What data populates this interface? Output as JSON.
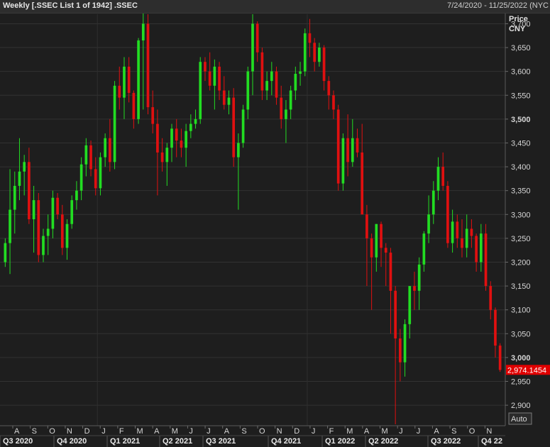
{
  "header": {
    "title": "Weekly [.SSEC List 1 of 1942] .SSEC",
    "date_range": "7/24/2020 - 11/25/2022 (NYC"
  },
  "axis": {
    "price_label": "Price",
    "currency_label": "CNY",
    "auto_button": "Auto",
    "last_price_label": "2,974.1454",
    "last_price_color": "#e00000"
  },
  "colors": {
    "up": "#22dd22",
    "down": "#e01010",
    "background": "#1e1e1e",
    "grid": "#333333"
  },
  "chart_data": {
    "type": "candlestick",
    "interval": "weekly",
    "instrument": ".SSEC",
    "ylim": [
      2860,
      3720
    ],
    "y_ticks": [
      2900,
      2950,
      3000,
      3050,
      3100,
      3150,
      3200,
      3250,
      3300,
      3350,
      3400,
      3450,
      3500,
      3550,
      3600,
      3650,
      3700
    ],
    "y_tick_labels": [
      "2,900",
      "2,950",
      "3,000",
      "3,050",
      "3,100",
      "3,150",
      "3,200",
      "3,250",
      "3,300",
      "3,350",
      "3,400",
      "3,450",
      "3,500",
      "3,550",
      "3,600",
      "3,650",
      "3,700"
    ],
    "y_bold_ticks": [
      3000,
      3500
    ],
    "month_labels": [
      "A",
      "S",
      "O",
      "N",
      "D",
      "J",
      "F",
      "M",
      "A",
      "M",
      "J",
      "J",
      "A",
      "S",
      "O",
      "N",
      "D",
      "J",
      "F",
      "M",
      "A",
      "M",
      "J",
      "J",
      "A",
      "S",
      "O",
      "N"
    ],
    "quarter_labels": [
      "Q3 2020",
      "Q4 2020",
      "Q1 2021",
      "Q2 2021",
      "Q3 2021",
      "Q4 2021",
      "Q1 2022",
      "Q2 2022",
      "Q3 2022",
      "Q4 22"
    ],
    "last_close": 2974.1454,
    "candles": [
      {
        "o": 3200,
        "h": 3250,
        "l": 3190,
        "c": 3240
      },
      {
        "o": 3240,
        "h": 3395,
        "l": 3175,
        "c": 3310
      },
      {
        "o": 3310,
        "h": 3390,
        "l": 3260,
        "c": 3360
      },
      {
        "o": 3360,
        "h": 3460,
        "l": 3330,
        "c": 3390
      },
      {
        "o": 3390,
        "h": 3425,
        "l": 3340,
        "c": 3410
      },
      {
        "o": 3410,
        "h": 3440,
        "l": 3280,
        "c": 3290
      },
      {
        "o": 3290,
        "h": 3360,
        "l": 3220,
        "c": 3330
      },
      {
        "o": 3330,
        "h": 3345,
        "l": 3200,
        "c": 3215
      },
      {
        "o": 3215,
        "h": 3270,
        "l": 3200,
        "c": 3255
      },
      {
        "o": 3255,
        "h": 3300,
        "l": 3215,
        "c": 3270
      },
      {
        "o": 3270,
        "h": 3350,
        "l": 3250,
        "c": 3335
      },
      {
        "o": 3335,
        "h": 3345,
        "l": 3290,
        "c": 3300
      },
      {
        "o": 3300,
        "h": 3320,
        "l": 3215,
        "c": 3230
      },
      {
        "o": 3230,
        "h": 3290,
        "l": 3205,
        "c": 3280
      },
      {
        "o": 3280,
        "h": 3340,
        "l": 3270,
        "c": 3330
      },
      {
        "o": 3330,
        "h": 3370,
        "l": 3310,
        "c": 3350
      },
      {
        "o": 3350,
        "h": 3420,
        "l": 3330,
        "c": 3405
      },
      {
        "o": 3405,
        "h": 3460,
        "l": 3380,
        "c": 3445
      },
      {
        "o": 3445,
        "h": 3455,
        "l": 3380,
        "c": 3395
      },
      {
        "o": 3395,
        "h": 3420,
        "l": 3340,
        "c": 3355
      },
      {
        "o": 3355,
        "h": 3430,
        "l": 3340,
        "c": 3420
      },
      {
        "o": 3420,
        "h": 3470,
        "l": 3400,
        "c": 3460
      },
      {
        "o": 3460,
        "h": 3500,
        "l": 3390,
        "c": 3410
      },
      {
        "o": 3410,
        "h": 3580,
        "l": 3395,
        "c": 3570
      },
      {
        "o": 3570,
        "h": 3610,
        "l": 3520,
        "c": 3545
      },
      {
        "o": 3545,
        "h": 3630,
        "l": 3500,
        "c": 3610
      },
      {
        "o": 3610,
        "h": 3630,
        "l": 3535,
        "c": 3555
      },
      {
        "o": 3555,
        "h": 3560,
        "l": 3480,
        "c": 3500
      },
      {
        "o": 3500,
        "h": 3670,
        "l": 3490,
        "c": 3665
      },
      {
        "o": 3665,
        "h": 3730,
        "l": 3520,
        "c": 3700
      },
      {
        "o": 3700,
        "h": 3720,
        "l": 3510,
        "c": 3525
      },
      {
        "o": 3525,
        "h": 3560,
        "l": 3470,
        "c": 3490
      },
      {
        "o": 3490,
        "h": 3520,
        "l": 3340,
        "c": 3430
      },
      {
        "o": 3430,
        "h": 3460,
        "l": 3390,
        "c": 3410
      },
      {
        "o": 3410,
        "h": 3450,
        "l": 3360,
        "c": 3440
      },
      {
        "o": 3440,
        "h": 3490,
        "l": 3410,
        "c": 3480
      },
      {
        "o": 3480,
        "h": 3500,
        "l": 3420,
        "c": 3455
      },
      {
        "o": 3455,
        "h": 3480,
        "l": 3420,
        "c": 3440
      },
      {
        "o": 3440,
        "h": 3490,
        "l": 3400,
        "c": 3475
      },
      {
        "o": 3475,
        "h": 3510,
        "l": 3460,
        "c": 3490
      },
      {
        "o": 3490,
        "h": 3520,
        "l": 3480,
        "c": 3500
      },
      {
        "o": 3500,
        "h": 3630,
        "l": 3490,
        "c": 3620
      },
      {
        "o": 3620,
        "h": 3630,
        "l": 3580,
        "c": 3600
      },
      {
        "o": 3600,
        "h": 3640,
        "l": 3560,
        "c": 3570
      },
      {
        "o": 3570,
        "h": 3625,
        "l": 3520,
        "c": 3610
      },
      {
        "o": 3610,
        "h": 3620,
        "l": 3540,
        "c": 3560
      },
      {
        "o": 3560,
        "h": 3590,
        "l": 3520,
        "c": 3530
      },
      {
        "o": 3530,
        "h": 3560,
        "l": 3510,
        "c": 3545
      },
      {
        "o": 3545,
        "h": 3565,
        "l": 3400,
        "c": 3420
      },
      {
        "o": 3420,
        "h": 3470,
        "l": 3310,
        "c": 3450
      },
      {
        "o": 3450,
        "h": 3530,
        "l": 3440,
        "c": 3520
      },
      {
        "o": 3520,
        "h": 3610,
        "l": 3500,
        "c": 3600
      },
      {
        "o": 3600,
        "h": 3720,
        "l": 3550,
        "c": 3700
      },
      {
        "o": 3700,
        "h": 3705,
        "l": 3620,
        "c": 3640
      },
      {
        "o": 3640,
        "h": 3650,
        "l": 3540,
        "c": 3560
      },
      {
        "o": 3560,
        "h": 3600,
        "l": 3540,
        "c": 3580
      },
      {
        "o": 3580,
        "h": 3620,
        "l": 3550,
        "c": 3600
      },
      {
        "o": 3600,
        "h": 3610,
        "l": 3530,
        "c": 3545
      },
      {
        "o": 3545,
        "h": 3570,
        "l": 3480,
        "c": 3500
      },
      {
        "o": 3500,
        "h": 3540,
        "l": 3450,
        "c": 3520
      },
      {
        "o": 3520,
        "h": 3570,
        "l": 3500,
        "c": 3560
      },
      {
        "o": 3560,
        "h": 3610,
        "l": 3540,
        "c": 3595
      },
      {
        "o": 3595,
        "h": 3620,
        "l": 3570,
        "c": 3600
      },
      {
        "o": 3600,
        "h": 3690,
        "l": 3590,
        "c": 3680
      },
      {
        "o": 3680,
        "h": 3710,
        "l": 3630,
        "c": 3660
      },
      {
        "o": 3660,
        "h": 3670,
        "l": 3600,
        "c": 3620
      },
      {
        "o": 3620,
        "h": 3660,
        "l": 3610,
        "c": 3650
      },
      {
        "o": 3650,
        "h": 3655,
        "l": 3560,
        "c": 3580
      },
      {
        "o": 3580,
        "h": 3590,
        "l": 3520,
        "c": 3550
      },
      {
        "o": 3550,
        "h": 3560,
        "l": 3500,
        "c": 3520
      },
      {
        "o": 3520,
        "h": 3530,
        "l": 3350,
        "c": 3365
      },
      {
        "o": 3365,
        "h": 3470,
        "l": 3350,
        "c": 3460
      },
      {
        "o": 3460,
        "h": 3510,
        "l": 3380,
        "c": 3410
      },
      {
        "o": 3410,
        "h": 3500,
        "l": 3400,
        "c": 3460
      },
      {
        "o": 3460,
        "h": 3480,
        "l": 3420,
        "c": 3430
      },
      {
        "o": 3430,
        "h": 3490,
        "l": 3350,
        "c": 3300
      },
      {
        "o": 3300,
        "h": 3320,
        "l": 3150,
        "c": 3250
      },
      {
        "o": 3250,
        "h": 3260,
        "l": 3100,
        "c": 3210
      },
      {
        "o": 3210,
        "h": 3280,
        "l": 3180,
        "c": 3280
      },
      {
        "o": 3280,
        "h": 3285,
        "l": 3190,
        "c": 3230
      },
      {
        "o": 3230,
        "h": 3240,
        "l": 3150,
        "c": 3220
      },
      {
        "o": 3220,
        "h": 3230,
        "l": 3050,
        "c": 3140
      },
      {
        "o": 3140,
        "h": 3150,
        "l": 2860,
        "c": 3040
      },
      {
        "o": 3040,
        "h": 3060,
        "l": 2950,
        "c": 2990
      },
      {
        "o": 2990,
        "h": 3080,
        "l": 2960,
        "c": 3070
      },
      {
        "o": 3070,
        "h": 3150,
        "l": 3040,
        "c": 3150
      },
      {
        "o": 3150,
        "h": 3180,
        "l": 3100,
        "c": 3140
      },
      {
        "o": 3140,
        "h": 3210,
        "l": 3100,
        "c": 3195
      },
      {
        "o": 3195,
        "h": 3265,
        "l": 3180,
        "c": 3260
      },
      {
        "o": 3260,
        "h": 3340,
        "l": 3240,
        "c": 3300
      },
      {
        "o": 3300,
        "h": 3370,
        "l": 3280,
        "c": 3350
      },
      {
        "o": 3350,
        "h": 3420,
        "l": 3330,
        "c": 3400
      },
      {
        "o": 3400,
        "h": 3430,
        "l": 3350,
        "c": 3360
      },
      {
        "o": 3360,
        "h": 3370,
        "l": 3230,
        "c": 3240
      },
      {
        "o": 3240,
        "h": 3310,
        "l": 3220,
        "c": 3285
      },
      {
        "o": 3285,
        "h": 3300,
        "l": 3230,
        "c": 3250
      },
      {
        "o": 3250,
        "h": 3290,
        "l": 3210,
        "c": 3230
      },
      {
        "o": 3230,
        "h": 3300,
        "l": 3210,
        "c": 3270
      },
      {
        "o": 3270,
        "h": 3290,
        "l": 3230,
        "c": 3255
      },
      {
        "o": 3255,
        "h": 3260,
        "l": 3180,
        "c": 3200
      },
      {
        "o": 3200,
        "h": 3280,
        "l": 3180,
        "c": 3260
      },
      {
        "o": 3260,
        "h": 3280,
        "l": 3140,
        "c": 3150
      },
      {
        "o": 3150,
        "h": 3160,
        "l": 3080,
        "c": 3100
      },
      {
        "o": 3100,
        "h": 3105,
        "l": 3000,
        "c": 3025
      },
      {
        "o": 3025,
        "h": 3030,
        "l": 2970,
        "c": 2974
      }
    ]
  }
}
